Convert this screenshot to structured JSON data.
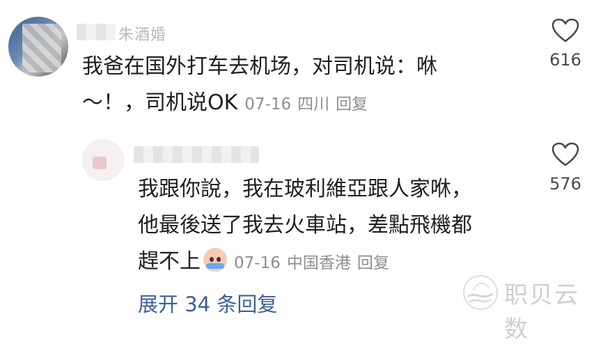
{
  "comment": {
    "username": "朱酒婚",
    "text_line1": "我爸在国外打车去机场，对司机说：咻",
    "text_line2": "～！，司机说OK",
    "date": "07-16",
    "location": "四川",
    "reply_label": "回复",
    "like_count": "616"
  },
  "reply": {
    "text_line1": "我跟你說，我在玻利維亞跟人家咻，",
    "text_line2": "他最後送了我去火車站，差點飛機都",
    "text_line3": "趕不上",
    "emoji": "crying-face",
    "date": "07-16",
    "location": "中国香港",
    "reply_label": "回复",
    "like_count": "576"
  },
  "expand_label": "展开 34 条回复",
  "watermark": "职贝云数",
  "colors": {
    "text": "#1f1f1f",
    "meta": "#8e8e8e",
    "link": "#3d5f96",
    "like_icon": "#4b4b4b"
  }
}
